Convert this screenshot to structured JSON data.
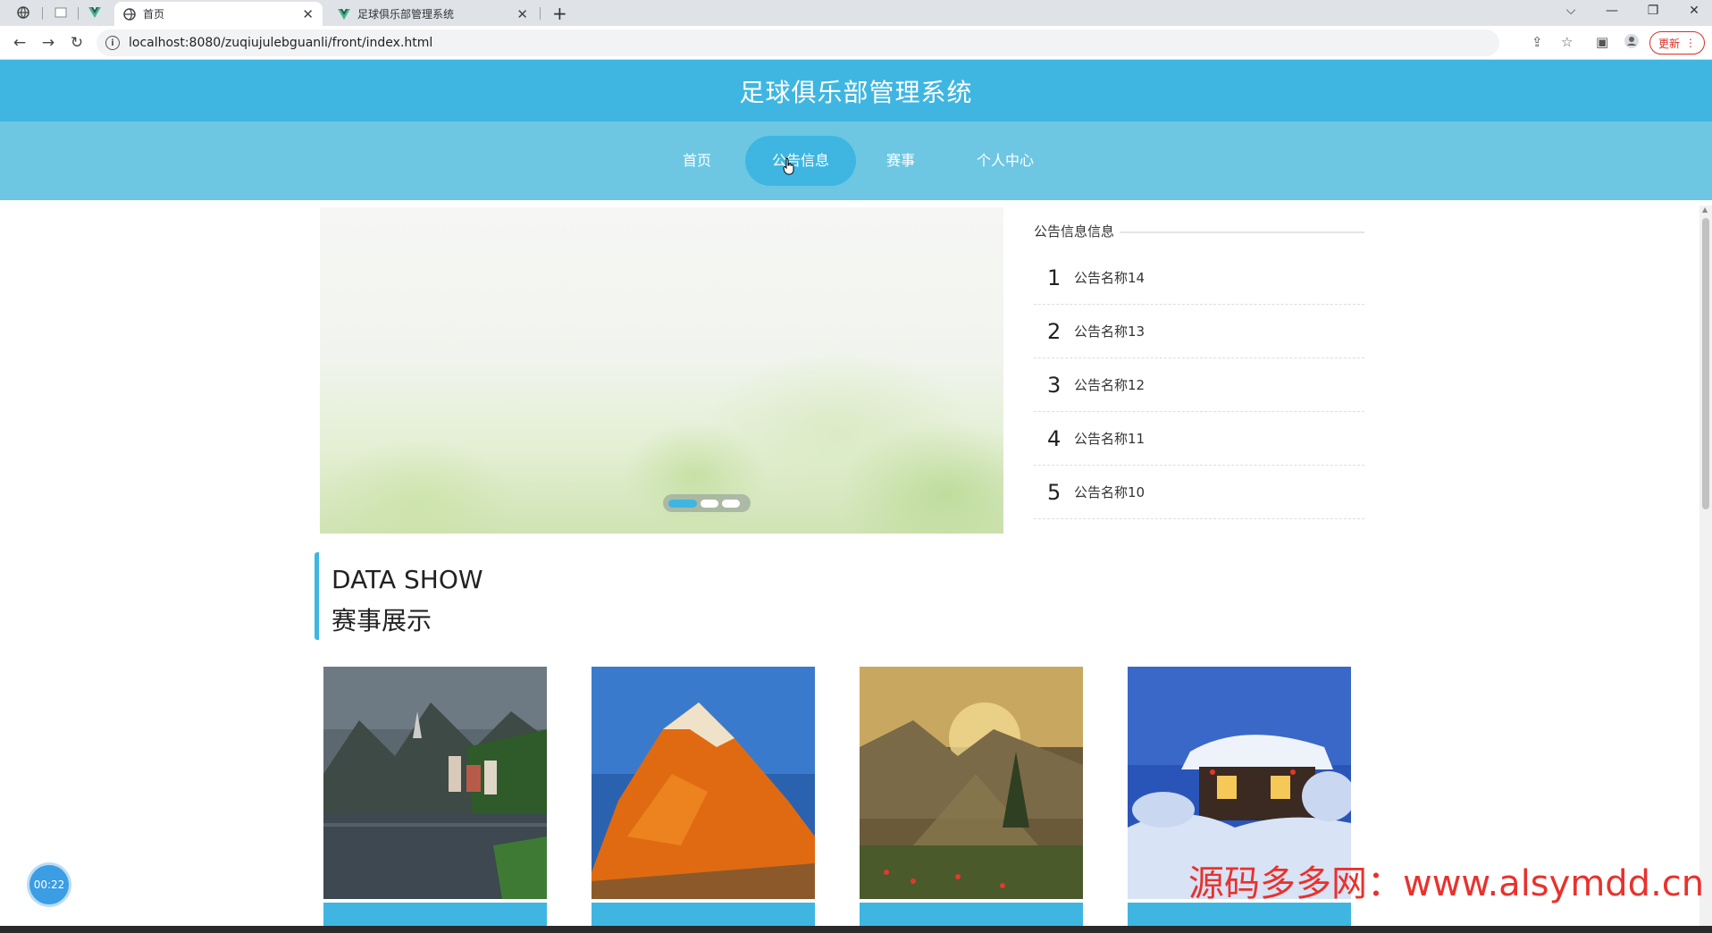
{
  "browser": {
    "tabs": [
      {
        "title": "首页",
        "active": true
      },
      {
        "title": "足球俱乐部管理系统",
        "active": false
      }
    ],
    "url": "localhost:8080/zuqiujulebguanli/front/index.html",
    "update_label": "更新"
  },
  "site": {
    "title": "足球俱乐部管理系统",
    "nav": [
      {
        "label": "首页",
        "active": false
      },
      {
        "label": "公告信息",
        "active": true
      },
      {
        "label": "赛事",
        "active": false
      },
      {
        "label": "个人中心",
        "active": false
      }
    ]
  },
  "banner": {
    "slides": 3,
    "current_slide": 1
  },
  "notice": {
    "heading": "公告信息信息",
    "items": [
      {
        "num": "1",
        "title": "公告名称14"
      },
      {
        "num": "2",
        "title": "公告名称13"
      },
      {
        "num": "3",
        "title": "公告名称12"
      },
      {
        "num": "4",
        "title": "公告名称11"
      },
      {
        "num": "5",
        "title": "公告名称10"
      }
    ]
  },
  "section": {
    "title_en": "DATA SHOW",
    "title_cn": "赛事展示"
  },
  "cards": [
    {
      "image": "lakeside-village-photo",
      "caption": ""
    },
    {
      "image": "orange-mountain-photo",
      "caption": ""
    },
    {
      "image": "sunset-valley-photo",
      "caption": ""
    },
    {
      "image": "snow-cabin-photo",
      "caption": ""
    }
  ],
  "overlay": {
    "timer": "00:22",
    "watermark": "源码多多网：www.alsymdd.cn"
  },
  "colors": {
    "primary": "#3fb6e1",
    "nav_bg": "#6dc7e2",
    "watermark": "#e8322d"
  }
}
